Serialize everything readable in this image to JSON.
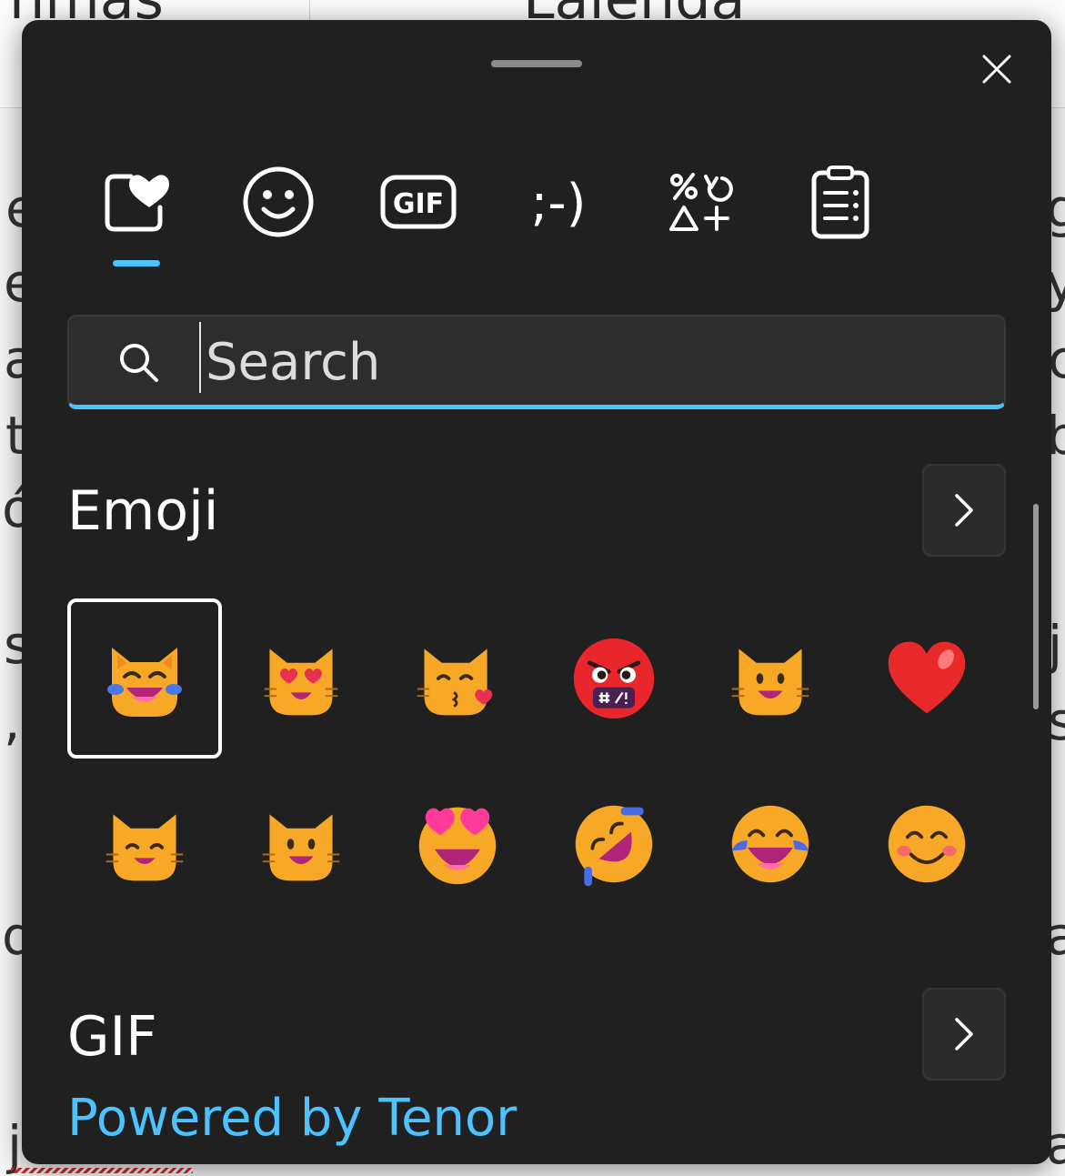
{
  "background_doc": {
    "top_text_left": "nmas",
    "top_text_right": "Lalehda",
    "left_chars": [
      "e",
      "e",
      "a",
      "t",
      "ó",
      "s",
      ",",
      "d",
      "j"
    ],
    "right_chars": [
      "g",
      "y",
      "c",
      "b",
      "j",
      "s",
      "a",
      "a"
    ]
  },
  "picker": {
    "close_icon": "close-icon",
    "tabs": [
      {
        "name": "favorites",
        "icon": "heart-favorites-icon",
        "selected": true
      },
      {
        "name": "emoji",
        "icon": "smiley-icon",
        "selected": false
      },
      {
        "name": "gif",
        "icon": "gif-icon",
        "label": "GIF",
        "selected": false
      },
      {
        "name": "kaomoji",
        "icon": "kaomoji-icon",
        "label": ";-)",
        "selected": false
      },
      {
        "name": "symbols",
        "icon": "symbols-icon",
        "selected": false
      },
      {
        "name": "clipboard",
        "icon": "clipboard-icon",
        "selected": false
      }
    ],
    "accent": "#4cc2ff",
    "search": {
      "placeholder": "Search",
      "value": ""
    },
    "emoji_section": {
      "title": "Emoji",
      "more_icon": "chevron-right-icon",
      "items": [
        {
          "name": "cat-with-tears-of-joy",
          "selected": true
        },
        {
          "name": "smiling-cat-with-heart-eyes"
        },
        {
          "name": "kissing-cat"
        },
        {
          "name": "face-with-symbols-on-mouth"
        },
        {
          "name": "grinning-cat"
        },
        {
          "name": "red-heart"
        },
        {
          "name": "grinning-cat-with-smiling-eyes"
        },
        {
          "name": "grinning-cat-big"
        },
        {
          "name": "smiling-face-with-heart-eyes"
        },
        {
          "name": "rolling-on-the-floor-laughing"
        },
        {
          "name": "face-with-tears-of-joy"
        },
        {
          "name": "smiling-face-with-smiling-eyes"
        }
      ]
    },
    "gif_section": {
      "title": "GIF",
      "more_icon": "chevron-right-icon",
      "powered_by": "Powered by Tenor"
    }
  }
}
